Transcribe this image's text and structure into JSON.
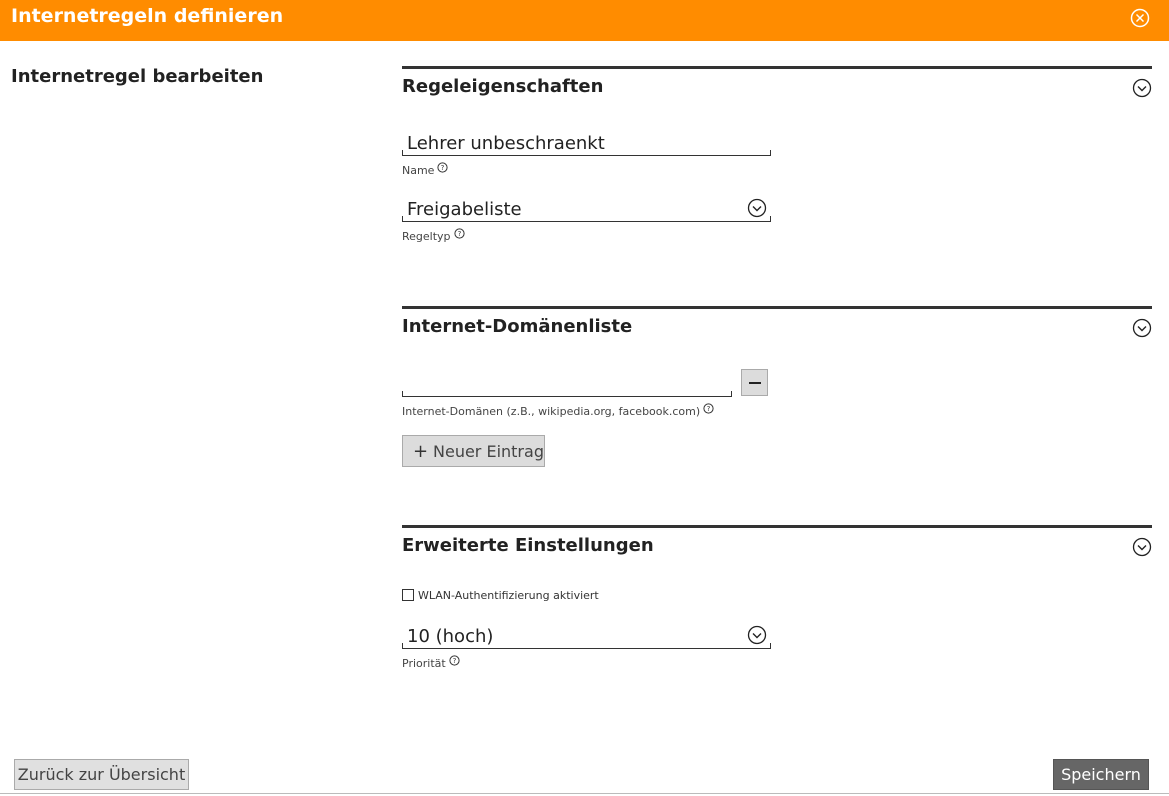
{
  "dialog": {
    "title": "Internetregeln definieren",
    "left_heading": "Internetregel bearbeiten"
  },
  "rule_properties": {
    "title": "Regeleigenschaften",
    "name_value": "Lehrer unbeschraenkt",
    "name_label": "Name",
    "type_value": "Freigabeliste",
    "type_label": "Regeltyp"
  },
  "domain_list": {
    "title": "Internet-Domänenliste",
    "domain_value": "",
    "domain_label": "Internet-Domänen (z.B., wikipedia.org, facebook.com)",
    "new_entry_label": "Neuer Eintrag"
  },
  "advanced": {
    "title": "Erweiterte Einstellungen",
    "wlan_label": "WLAN-Authentifizierung aktiviert",
    "wlan_checked": false,
    "priority_value": "10 (hoch)",
    "priority_label": "Priorität"
  },
  "footer": {
    "back_label": "Zurück zur Übersicht",
    "save_label": "Speichern"
  },
  "colors": {
    "header": "#ff8c00",
    "save_button": "#666666"
  }
}
